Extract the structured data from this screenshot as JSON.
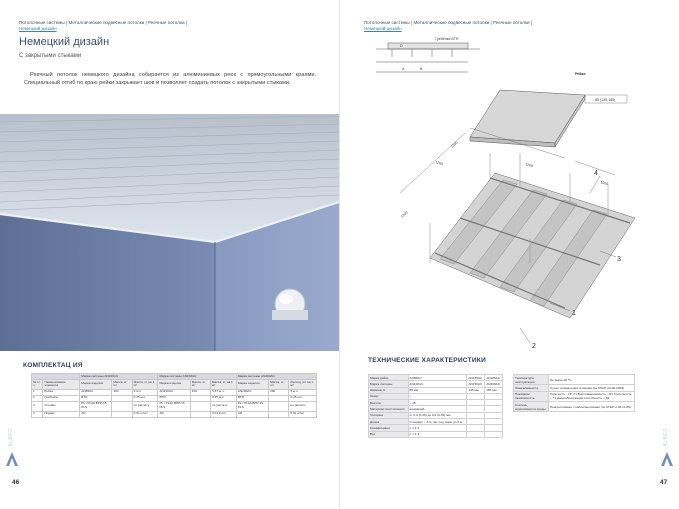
{
  "left_page": {
    "breadcrumb": {
      "path": "Потолочные системы | Металлические подвесные потолки | Реечные потолки |",
      "current": "Немецкий дизайн"
    },
    "title": "Немецкий дизайн",
    "subtitle": "С закрытыми стыками",
    "paragraph": "Реечный потолок немецкого дизайна собирается из алюминиевых реек с прямоугольными краями. Специальный отгиб по краю рейки закрывает шов и позволяет создать потолок с закрытыми стыками.",
    "section_title": "КОМПЛЕКТАЦ ИЯ",
    "table": {
      "groups": [
        "Марка системы AN100AC",
        "Марка системы AN150AC",
        "Марка системы AN200AC"
      ],
      "header": [
        "№ п/ п",
        "Наименование элемента",
        "Марка изделия",
        "Масса, кг, шт",
        "Масса, кг, на 1 м²",
        "Марка изделия",
        "Масса, кг, шт",
        "Масса, кг, на 1 м²",
        "Марка изделия",
        "Масса, кг, шт",
        "Расход, шт на 1 м²"
      ],
      "rows": [
        [
          "1",
          "Рейка",
          "AN85AC",
          "100",
          "9 м.п.",
          "AN150AC",
          "150",
          "6.67 м.п.",
          "AN200AC",
          "200",
          "5 м.п."
        ],
        [
          "2",
          "Гребёнка",
          "BTR",
          "",
          "0.25 м.п.",
          "BTR",
          "",
          "0.25 м.п.",
          "BTR",
          "",
          "0.25 м.п."
        ],
        [
          "3",
          "Угловик",
          "PL / PL2A BPP-15 PLS",
          "",
          "по расчёту",
          "PL / PL2A BPP-15 PLS",
          "",
          "по расчёту",
          "PL / PL2A BPP-15 PLS",
          "",
          "по расчёту"
        ],
        [
          "4",
          "Подвес",
          "AR",
          "",
          "0.01 кг/шт",
          "AR",
          "",
          "0.01 кг/шт",
          "AR",
          "",
          "0.01 кг/шт"
        ]
      ]
    },
    "page_number": "46",
    "side_brand": "ALBES"
  },
  "right_page": {
    "breadcrumb": {
      "path": "Потолочные системы | Металлические подвесные потолки | Реечные потолки |",
      "current": "Немецкий дизайн"
    },
    "diagram_labels": {
      "comb": "Гребёнка BTR",
      "rail": "Рейка",
      "rail_dim": "85 (135,185)",
      "dim_d": "D",
      "dim_a": "A",
      "dim_b": "B",
      "dim_1200a": "1200",
      "dim_1200b": "1200",
      "dim_1200c": "1200",
      "dim_1200d": "1200",
      "dim_1000": "1000",
      "callout_1": "1",
      "callout_2": "2",
      "callout_3": "3",
      "callout_4": "4"
    },
    "section_title": "ТЕХНИЧЕСКИЕ ХАРАКТЕРИСТИКИ",
    "spec_left": [
      [
        "Марка рейки",
        "AN85AC",
        "AN135AC",
        "AN185AC"
      ],
      [
        "Марка системы",
        "AN100AC",
        "AN150AC",
        "AN200AC"
      ],
      [
        "Ширина, А",
        "85 мм",
        "135 мм",
        "185 мм"
      ],
      [
        "Зазор",
        "~",
        "",
        ""
      ],
      [
        "Высота",
        "~ 15",
        "",
        ""
      ],
      [
        "Материал изготовления",
        "алюминий",
        "",
        ""
      ],
      [
        "Толщина",
        "от 0,3 (0,35) до 0,6 (0,55) мм",
        "",
        ""
      ],
      [
        "Длина",
        "Стандарт – 3 м, 4м, под заказ до 6 м",
        "",
        ""
      ],
      [
        "Коэффициент",
        "α = 1,3",
        "",
        ""
      ],
      [
        "Вес",
        "α = 1,3",
        "",
        ""
      ]
    ],
    "spec_right": [
      [
        "Температура эксплуатации",
        "Не выше 90 °С"
      ],
      [
        "Зона влажности",
        "Сухая, нормальная, влажная (по СНиП 23-02-2003)"
      ],
      [
        "Пожарная безопасность",
        "Горючесть – НГ, Г1 Воспламеняемость – В1 Токсичность – Т1 Дымообразующая способность – Д1"
      ],
      [
        "Степень агрессивности среды",
        "Неагрессивная, слабоагрессивная (по СНиП 2.03.11-85)"
      ]
    ],
    "page_number": "47",
    "side_brand": "ALBES"
  },
  "colors": {
    "heading": "#3a4e6a",
    "link": "#3f7fbf",
    "accent_triangle": "#6d8fb8"
  }
}
